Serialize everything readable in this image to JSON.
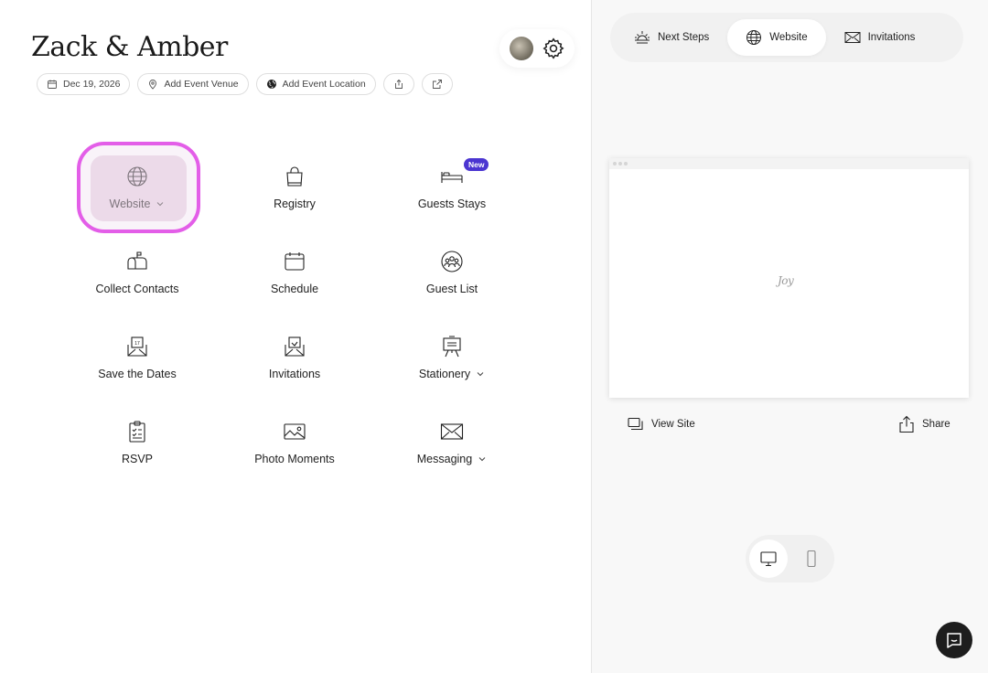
{
  "event": {
    "title": "Zack & Amber",
    "chips": {
      "date": "Dec 19, 2026",
      "venue": "Add Event Venue",
      "location": "Add Event Location"
    }
  },
  "tiles": [
    {
      "label": "Website",
      "icon": "globe-icon",
      "dropdown": true,
      "active": true
    },
    {
      "label": "Registry",
      "icon": "shopping-bag-icon"
    },
    {
      "label": "Guests Stays",
      "icon": "bed-icon",
      "badge": "New"
    },
    {
      "label": "Collect Contacts",
      "icon": "mailbox-icon"
    },
    {
      "label": "Schedule",
      "icon": "calendar-icon"
    },
    {
      "label": "Guest List",
      "icon": "people-group-icon"
    },
    {
      "label": "Save the Dates",
      "icon": "save-the-date-envelope-icon"
    },
    {
      "label": "Invitations",
      "icon": "invitation-envelope-icon"
    },
    {
      "label": "Stationery",
      "icon": "easel-icon",
      "dropdown": true
    },
    {
      "label": "RSVP",
      "icon": "clipboard-checklist-icon"
    },
    {
      "label": "Photo Moments",
      "icon": "photo-icon"
    },
    {
      "label": "Messaging",
      "icon": "envelope-icon",
      "dropdown": true
    }
  ],
  "right_panel": {
    "tabs": [
      {
        "label": "Next Steps",
        "icon": "sunrise-icon"
      },
      {
        "label": "Website",
        "icon": "globe-icon",
        "active": true
      },
      {
        "label": "Invitations",
        "icon": "envelope-icon"
      }
    ],
    "preview_logo": "Joy",
    "view_site": "View Site",
    "share": "Share",
    "device_toggle": {
      "selected": "desktop",
      "options": [
        "desktop",
        "mobile"
      ]
    }
  },
  "colors": {
    "highlight": "#e35ee8",
    "badge": "#4b35d1",
    "chat_button": "#1d1d1d"
  }
}
